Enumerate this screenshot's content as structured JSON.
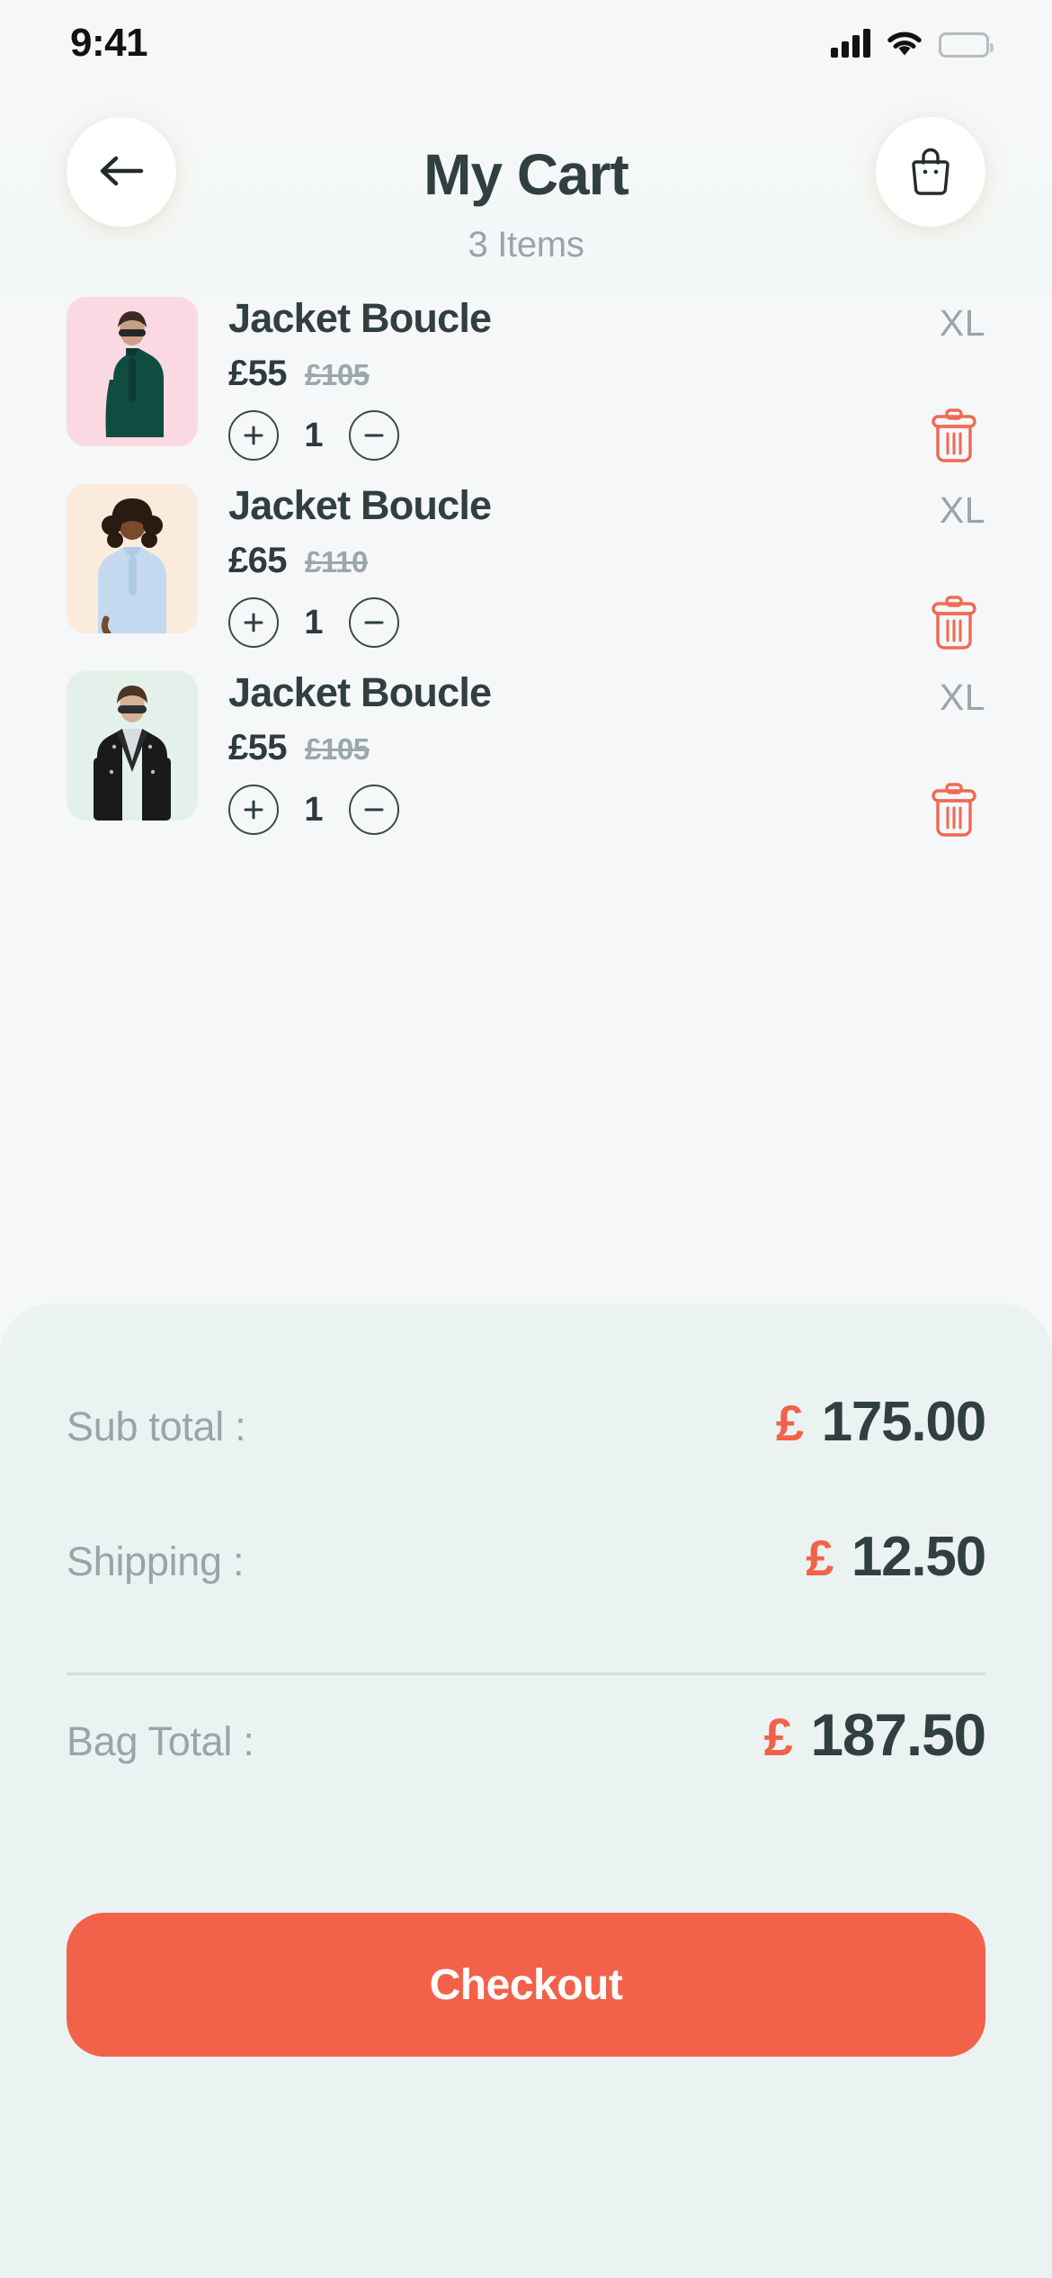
{
  "status_bar": {
    "time": "9:41",
    "signal_icon": "cellular-signal-icon",
    "wifi_icon": "wifi-icon",
    "battery_icon": "battery-full-icon"
  },
  "header": {
    "back_icon": "arrow-left-icon",
    "title": "My Cart",
    "subtitle": "3 Items",
    "bag_icon": "shopping-bag-icon"
  },
  "colors": {
    "accent": "#f2624a",
    "text_dark": "#30403f",
    "text_muted": "#9aa4a8",
    "panel_bg": "#ebf3f2",
    "page_bg": "#f5f7f8"
  },
  "cart": {
    "items": [
      {
        "name": "Jacket Boucle",
        "price": "£55",
        "original_price": "£105",
        "size": "XL",
        "quantity": "1",
        "thumb_bg": "#fbd9e3",
        "increase_icon": "plus-circle-icon",
        "decrease_icon": "minus-circle-icon",
        "delete_icon": "trash-icon"
      },
      {
        "name": "Jacket Boucle",
        "price": "£65",
        "original_price": "£110",
        "size": "XL",
        "quantity": "1",
        "thumb_bg": "#fbebdc",
        "increase_icon": "plus-circle-icon",
        "decrease_icon": "minus-circle-icon",
        "delete_icon": "trash-icon"
      },
      {
        "name": "Jacket Boucle",
        "price": "£55",
        "original_price": "£105",
        "size": "XL",
        "quantity": "1",
        "thumb_bg": "#e3f1ea",
        "increase_icon": "plus-circle-icon",
        "decrease_icon": "minus-circle-icon",
        "delete_icon": "trash-icon"
      }
    ]
  },
  "summary": {
    "subtotal_label": "Sub total :",
    "subtotal_currency": "£",
    "subtotal_amount": "175.00",
    "shipping_label": "Shipping :",
    "shipping_currency": "£",
    "shipping_amount": "12.50",
    "total_label": "Bag Total :",
    "total_currency": "£",
    "total_amount": "187.50",
    "checkout_label": "Checkout"
  }
}
